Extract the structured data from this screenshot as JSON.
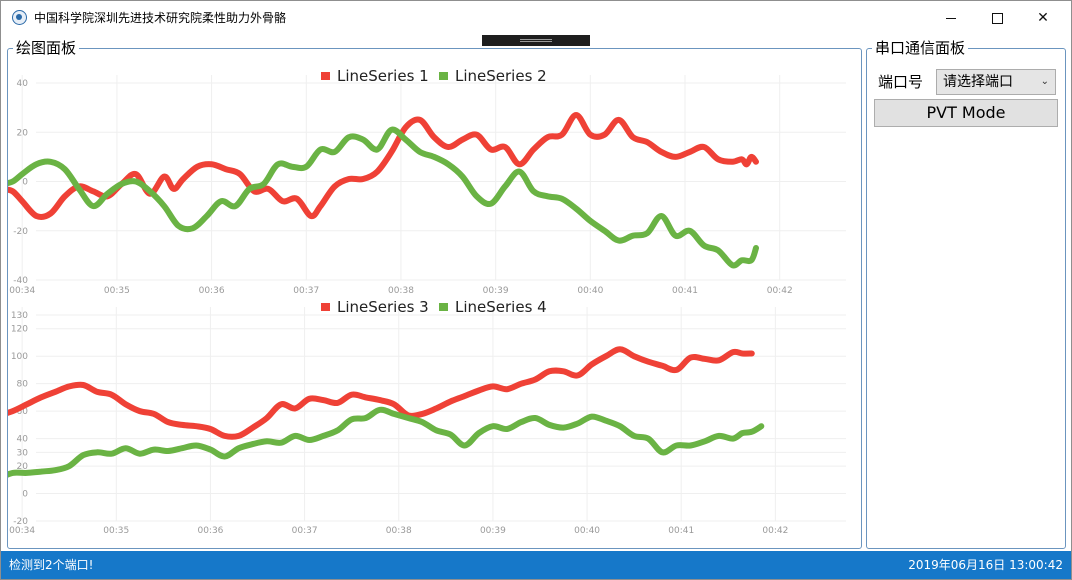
{
  "window": {
    "title": "中国科学院深圳先进技术研究院柔性助力外骨骼",
    "minimize_glyph": "",
    "maximize_glyph": "",
    "close_glyph": "✕"
  },
  "draw_panel": {
    "title": "绘图面板"
  },
  "serial_panel": {
    "title": "串口通信面板",
    "port_label": "端口号",
    "port_select_value": "请选择端口",
    "pvt_button_label": "PVT Mode"
  },
  "status_bar": {
    "left_text": "检测到2个端口!",
    "right_text": "2019年06月16日 13:00:42"
  },
  "colors": {
    "series_red": "#ef4136",
    "series_green": "#6ab344",
    "accent_blue": "#1678c9",
    "grid": "#efefef"
  },
  "chart_data": [
    {
      "type": "line",
      "title": "",
      "xlabel": "",
      "ylabel": "",
      "x_unit": "time mm:ss",
      "ylim": [
        -40,
        40
      ],
      "xlim": [
        33.85,
        42.7
      ],
      "y_ticks": [
        "40",
        "20",
        "0",
        "-20",
        "-40"
      ],
      "x_ticks": [
        "00:34",
        "00:35",
        "00:36",
        "00:37",
        "00:38",
        "00:39",
        "00:40",
        "00:41",
        "00:42"
      ],
      "legend_position": "top-center",
      "grid": true,
      "series": [
        {
          "name": "LineSeries 1",
          "color": "#ef4136",
          "x": [
            33.8,
            33.9,
            34.0,
            34.15,
            34.3,
            34.45,
            34.6,
            34.75,
            34.9,
            35.05,
            35.2,
            35.35,
            35.5,
            35.6,
            35.7,
            35.85,
            36.0,
            36.15,
            36.3,
            36.45,
            36.6,
            36.75,
            36.9,
            37.05,
            37.15,
            37.3,
            37.45,
            37.6,
            37.75,
            37.9,
            38.05,
            38.2,
            38.35,
            38.5,
            38.65,
            38.8,
            38.95,
            39.1,
            39.25,
            39.4,
            39.55,
            39.7,
            39.85,
            40.0,
            40.15,
            40.3,
            40.45,
            40.6,
            40.75,
            40.9,
            41.05,
            41.2,
            41.35,
            41.5,
            41.6,
            41.65,
            41.7,
            41.75
          ],
          "y": [
            -3,
            -4,
            -8,
            -14,
            -13,
            -6,
            -2,
            -4,
            -6,
            -1,
            3,
            -5,
            2,
            -3,
            1,
            6,
            7,
            5,
            3,
            -4,
            -3,
            -8,
            -7,
            -14,
            -10,
            -2,
            1,
            1,
            4,
            12,
            22,
            25,
            18,
            14,
            17,
            19,
            13,
            14,
            7,
            13,
            18,
            19,
            27,
            19,
            19,
            25,
            18,
            16,
            12,
            10,
            12,
            14,
            9,
            8,
            9,
            7,
            10,
            8
          ]
        },
        {
          "name": "LineSeries 2",
          "color": "#6ab344",
          "x": [
            33.8,
            33.9,
            34.0,
            34.15,
            34.3,
            34.45,
            34.6,
            34.75,
            34.9,
            35.05,
            35.2,
            35.35,
            35.5,
            35.65,
            35.8,
            35.95,
            36.1,
            36.25,
            36.4,
            36.55,
            36.7,
            36.85,
            37.0,
            37.15,
            37.3,
            37.45,
            37.6,
            37.75,
            37.9,
            38.05,
            38.2,
            38.35,
            38.5,
            38.65,
            38.8,
            38.95,
            39.1,
            39.25,
            39.4,
            39.55,
            39.7,
            39.85,
            40.0,
            40.15,
            40.3,
            40.45,
            40.6,
            40.75,
            40.9,
            41.05,
            41.2,
            41.35,
            41.5,
            41.6,
            41.7,
            41.75
          ],
          "y": [
            -1,
            0,
            3,
            7,
            8,
            5,
            -3,
            -10,
            -5,
            -1,
            0,
            -4,
            -10,
            -18,
            -19,
            -14,
            -8,
            -10,
            -3,
            -1,
            7,
            6,
            6,
            13,
            12,
            18,
            17,
            13,
            21,
            17,
            12,
            10,
            7,
            2,
            -6,
            -9,
            -2,
            4,
            -4,
            -6,
            -7,
            -11,
            -16,
            -20,
            -24,
            -22,
            -21,
            -14,
            -22,
            -20,
            -26,
            -28,
            -34,
            -32,
            -32,
            -27
          ]
        }
      ]
    },
    {
      "type": "line",
      "title": "",
      "xlabel": "",
      "ylabel": "",
      "x_unit": "time mm:ss",
      "ylim": [
        -20,
        130
      ],
      "xlim": [
        33.85,
        42.75
      ],
      "y_ticks": [
        "130",
        "120",
        "100",
        "80",
        "60",
        "40",
        "30",
        "20",
        "0",
        "-20"
      ],
      "x_ticks": [
        "00:34",
        "00:35",
        "00:36",
        "00:37",
        "00:38",
        "00:39",
        "00:40",
        "00:41",
        "00:42"
      ],
      "legend_position": "top-center",
      "grid": true,
      "series": [
        {
          "name": "LineSeries 3",
          "color": "#ef4136",
          "x": [
            33.75,
            33.9,
            34.05,
            34.2,
            34.35,
            34.5,
            34.65,
            34.8,
            34.95,
            35.1,
            35.25,
            35.4,
            35.55,
            35.7,
            35.85,
            36.0,
            36.15,
            36.3,
            36.45,
            36.6,
            36.75,
            36.9,
            37.05,
            37.2,
            37.35,
            37.5,
            37.65,
            37.8,
            37.95,
            38.1,
            38.25,
            38.4,
            38.55,
            38.7,
            38.85,
            39.0,
            39.15,
            39.3,
            39.45,
            39.6,
            39.75,
            39.9,
            40.05,
            40.2,
            40.35,
            40.5,
            40.65,
            40.8,
            40.95,
            41.1,
            41.25,
            41.4,
            41.55,
            41.65,
            41.75
          ],
          "y": [
            57,
            60,
            65,
            70,
            74,
            78,
            79,
            74,
            72,
            65,
            60,
            58,
            52,
            50,
            49,
            47,
            42,
            42,
            48,
            55,
            65,
            62,
            69,
            68,
            66,
            72,
            70,
            68,
            65,
            57,
            58,
            62,
            67,
            71,
            75,
            78,
            76,
            80,
            83,
            89,
            89,
            86,
            94,
            100,
            105,
            100,
            96,
            93,
            90,
            99,
            98,
            97,
            103,
            102,
            102
          ]
        },
        {
          "name": "LineSeries 4",
          "color": "#6ab344",
          "x": [
            33.75,
            33.9,
            34.05,
            34.2,
            34.35,
            34.5,
            34.65,
            34.8,
            34.95,
            35.1,
            35.25,
            35.4,
            35.55,
            35.7,
            35.85,
            36.0,
            36.15,
            36.3,
            36.45,
            36.6,
            36.75,
            36.9,
            37.05,
            37.2,
            37.35,
            37.5,
            37.65,
            37.8,
            37.95,
            38.1,
            38.25,
            38.4,
            38.55,
            38.7,
            38.85,
            39.0,
            39.15,
            39.3,
            39.45,
            39.6,
            39.75,
            39.9,
            40.05,
            40.2,
            40.35,
            40.5,
            40.65,
            40.8,
            40.95,
            41.1,
            41.25,
            41.4,
            41.55,
            41.65,
            41.75,
            41.85
          ],
          "y": [
            11,
            15,
            15,
            16,
            17,
            20,
            28,
            30,
            29,
            33,
            29,
            32,
            31,
            33,
            35,
            32,
            27,
            33,
            36,
            38,
            37,
            42,
            39,
            42,
            46,
            54,
            55,
            61,
            58,
            55,
            52,
            46,
            43,
            35,
            44,
            49,
            47,
            52,
            55,
            50,
            48,
            51,
            56,
            53,
            49,
            42,
            40,
            30,
            35,
            35,
            38,
            42,
            40,
            44,
            45,
            49
          ]
        }
      ]
    }
  ]
}
